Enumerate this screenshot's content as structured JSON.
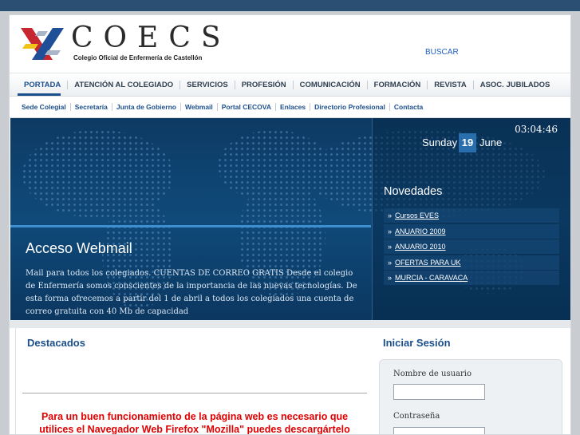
{
  "header": {
    "logo_title": "COECS",
    "logo_subtitle": "Colegio Oficial de Enfermería de Castellón",
    "search_link": "BUSCAR"
  },
  "main_nav": [
    {
      "label": "PORTADA",
      "active": true
    },
    {
      "label": "ATENCIÓN AL COLEGIADO",
      "active": false
    },
    {
      "label": "SERVICIOS",
      "active": false
    },
    {
      "label": "PROFESIÓN",
      "active": false
    },
    {
      "label": "COMUNICACIÓN",
      "active": false
    },
    {
      "label": "FORMACIÓN",
      "active": false
    },
    {
      "label": "REVISTA",
      "active": false
    },
    {
      "label": "ASOC. JUBILADOS",
      "active": false
    }
  ],
  "sub_nav": [
    {
      "label": "Sede Colegial"
    },
    {
      "label": "Secretaría"
    },
    {
      "label": "Junta de Gobierno"
    },
    {
      "label": "Webmail"
    },
    {
      "label": "Portal CECOVA"
    },
    {
      "label": "Enlaces"
    },
    {
      "label": "Directorio Profesional"
    },
    {
      "label": "Contacta"
    }
  ],
  "banner": {
    "title": "Acceso Webmail",
    "text": "Mail para todos los colegiados. CUENTAS DE CORREO GRATIS Desde el colegio de Enfermería somos conscientes de la importancia de las nuevas tecnologías. De esta forma ofrecemos a partir del 1 de abril a todos los colegiados una cuenta de correo gratuita con 40 Mb de capacidad"
  },
  "clock": {
    "time": "03:04:46",
    "weekday": "Sunday",
    "day": "19",
    "month": "June"
  },
  "novedades": {
    "title": "Novedades",
    "items": [
      {
        "label": "Cursos EVES"
      },
      {
        "label": "ANUARIO 2009"
      },
      {
        "label": "ANUARIO 2010"
      },
      {
        "label": "OFERTAS PARA UK"
      },
      {
        "label": "MURCIA - CARAVACA"
      }
    ]
  },
  "destacados": {
    "title": "Destacados",
    "message_line1": "Para un buen funcionamiento de la página web es necesario que",
    "message_line2": "utilices el Navegador Web Firefox \"Mozilla\" puedes descargártelo"
  },
  "login": {
    "title": "Iniciar Sesión",
    "username_label": "Nombre de usuario",
    "username_value": "",
    "password_label": "Contraseña",
    "password_value": ""
  },
  "colors": {
    "brand_blue": "#1b4f8c",
    "banner_bg": "#0f4a7a",
    "alert_red": "#e00000",
    "top_bar": "#2b4f73"
  },
  "icons": {
    "logo_mark": "coecs-x-logo-icon",
    "list_bullet": "double-chevron-right-icon"
  }
}
